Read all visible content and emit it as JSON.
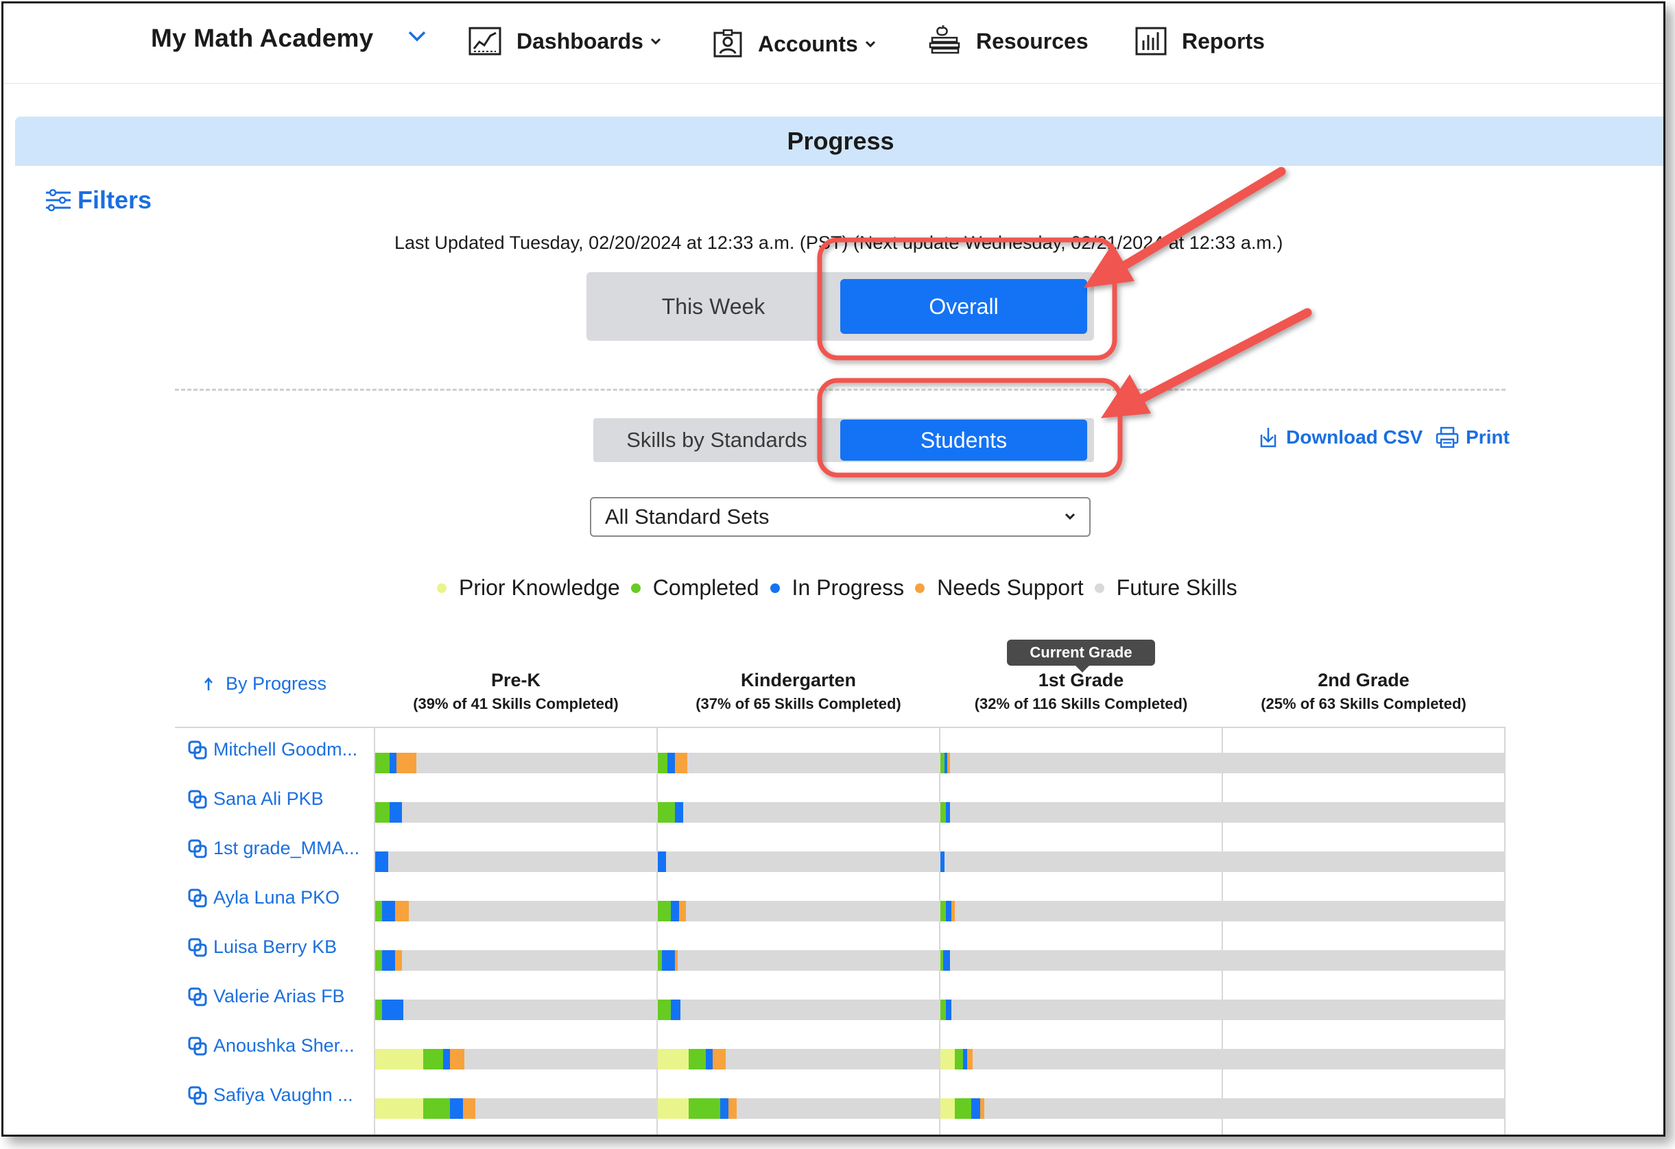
{
  "nav": {
    "brand": "My Math Academy",
    "items": [
      {
        "label": "Dashboards",
        "icon": "chart-icon",
        "has_caret": true
      },
      {
        "label": "Accounts",
        "icon": "accounts-icon",
        "has_caret": true
      },
      {
        "label": "Resources",
        "icon": "resources-icon",
        "has_caret": false
      },
      {
        "label": "Reports",
        "icon": "reports-icon",
        "has_caret": false
      }
    ]
  },
  "page": {
    "title": "Progress",
    "filters_label": "Filters",
    "last_updated": "Last Updated Tuesday, 02/20/2024 at 12:33 a.m. (PST) (Next update Wednesday, 02/21/2024 at 12:33 a.m.)"
  },
  "time_toggle": {
    "options": [
      "This Week",
      "Overall"
    ],
    "selected": "Overall"
  },
  "view_toggle": {
    "options": [
      "Skills by Standards",
      "Students"
    ],
    "selected": "Students"
  },
  "actions": {
    "download_csv": "Download CSV",
    "print": "Print"
  },
  "standard_select": {
    "value": "All Standard Sets"
  },
  "legend": [
    {
      "label": "Prior Knowledge",
      "color": "#e9f58a"
    },
    {
      "label": "Completed",
      "color": "#66cc22"
    },
    {
      "label": "In Progress",
      "color": "#1473f4"
    },
    {
      "label": "Needs Support",
      "color": "#f7a23c"
    },
    {
      "label": "Future Skills",
      "color": "#d9d9d9"
    }
  ],
  "table": {
    "sort_label": "By Progress",
    "current_grade_label": "Current Grade",
    "columns": [
      {
        "name": "Pre-K",
        "summary": "(39% of 41 Skills Completed)",
        "current": false
      },
      {
        "name": "Kindergarten",
        "summary": "(37% of 65 Skills Completed)",
        "current": false
      },
      {
        "name": "1st Grade",
        "summary": "(32% of 116 Skills Completed)",
        "current": true
      },
      {
        "name": "2nd Grade",
        "summary": "(25% of 63 Skills Completed)",
        "current": false
      }
    ],
    "students": [
      {
        "name": "Mitchell Goodm...",
        "progress": [
          [
            0,
            0.05,
            0.025,
            0.07
          ],
          [
            0,
            0.035,
            0.025,
            0.045
          ],
          [
            0,
            0.015,
            0.01,
            0.01
          ],
          [
            0,
            0,
            0,
            0
          ]
        ]
      },
      {
        "name": "Sana Ali PKB",
        "progress": [
          [
            0,
            0.05,
            0.045,
            0
          ],
          [
            0,
            0.06,
            0.03,
            0
          ],
          [
            0,
            0.02,
            0.015,
            0
          ],
          [
            0,
            0,
            0,
            0
          ]
        ]
      },
      {
        "name": "1st grade_MMA...",
        "progress": [
          [
            0,
            0,
            0.045,
            0
          ],
          [
            0,
            0,
            0.03,
            0
          ],
          [
            0,
            0,
            0.015,
            0
          ],
          [
            0,
            0,
            0,
            0
          ]
        ]
      },
      {
        "name": "Ayla Luna PKO",
        "progress": [
          [
            0,
            0.025,
            0.045,
            0.05
          ],
          [
            0,
            0.045,
            0.03,
            0.025
          ],
          [
            0,
            0.02,
            0.02,
            0.01
          ],
          [
            0,
            0,
            0,
            0
          ]
        ]
      },
      {
        "name": "Luisa Berry KB",
        "progress": [
          [
            0,
            0.025,
            0.045,
            0.025
          ],
          [
            0,
            0.015,
            0.045,
            0.01
          ],
          [
            0,
            0.01,
            0.025,
            0
          ],
          [
            0,
            0,
            0,
            0
          ]
        ]
      },
      {
        "name": "Valerie Arias FB",
        "progress": [
          [
            0,
            0.025,
            0.075,
            0
          ],
          [
            0,
            0.045,
            0.035,
            0
          ],
          [
            0,
            0.02,
            0.02,
            0
          ],
          [
            0,
            0,
            0,
            0
          ]
        ]
      },
      {
        "name": "Anoushka Sher...",
        "progress": [
          [
            0.17,
            0.07,
            0.025,
            0.05
          ],
          [
            0.11,
            0.06,
            0.025,
            0.045
          ],
          [
            0.05,
            0.03,
            0.015,
            0.02
          ],
          [
            0,
            0,
            0,
            0
          ]
        ]
      },
      {
        "name": "Safiya Vaughn ...",
        "progress": [
          [
            0.17,
            0.095,
            0.045,
            0.045
          ],
          [
            0.11,
            0.11,
            0.03,
            0.03
          ],
          [
            0.05,
            0.06,
            0.03,
            0.015
          ],
          [
            0,
            0,
            0,
            0
          ]
        ]
      }
    ]
  }
}
